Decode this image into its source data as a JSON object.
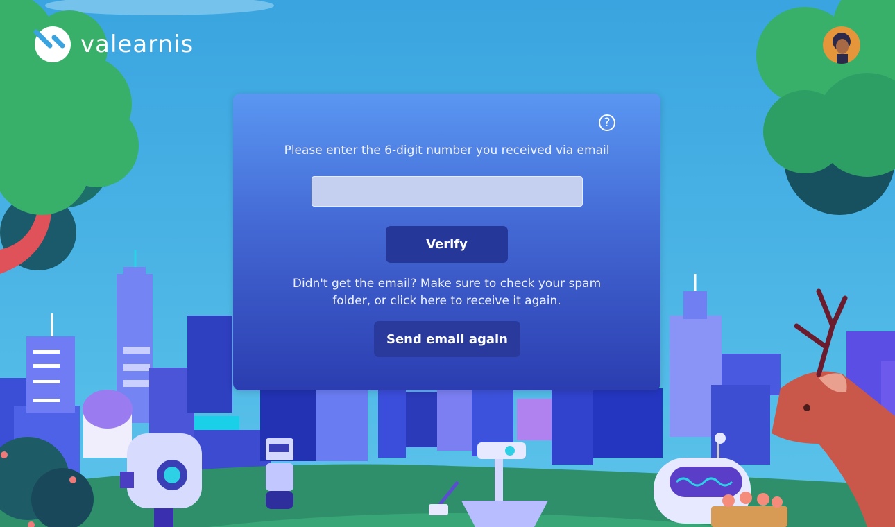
{
  "brand": {
    "name": "valearnis",
    "logo_icon": "valearnis-logo-icon"
  },
  "user": {
    "avatar_icon": "user-avatar"
  },
  "verification": {
    "help_icon": "question-circle-icon",
    "help_glyph": "?",
    "prompt": "Please enter the 6-digit number you received via email",
    "code_value": "",
    "code_placeholder": "",
    "verify_label": "Verify",
    "help_text": "Didn't get the email? Make sure to check your spam folder, or click here to receive it again.",
    "resend_label": "Send email again"
  },
  "colors": {
    "sky": "#4fb0e4",
    "card_top": "#5a97f2",
    "card_bottom": "#2b3db0",
    "button": "#26379a",
    "grass": "#2f8f6a"
  }
}
